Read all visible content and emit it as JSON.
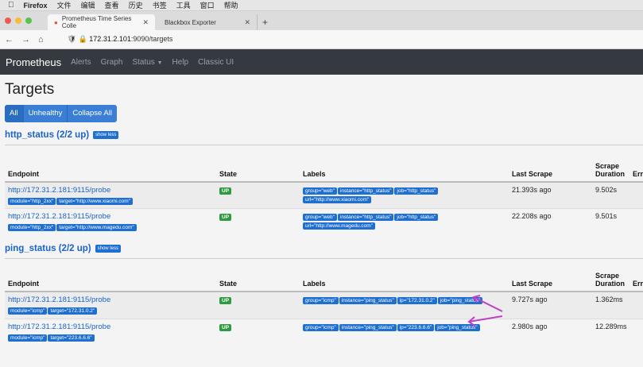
{
  "os_menu": {
    "app": "Firefox",
    "items": [
      "文件",
      "编辑",
      "查看",
      "历史",
      "书签",
      "工具",
      "窗口",
      "帮助"
    ]
  },
  "browser": {
    "tabs": [
      {
        "title": "Prometheus Time Series Colle"
      },
      {
        "title": "Blackbox Exporter"
      }
    ],
    "url_prefix": "172.31.2.101",
    "url_rest": ":9090/targets"
  },
  "nav": {
    "brand": "Prometheus",
    "links": [
      "Alerts",
      "Graph",
      "Status",
      "Help",
      "Classic UI"
    ]
  },
  "page": {
    "title": "Targets",
    "filters": [
      "All",
      "Unhealthy",
      "Collapse All"
    ],
    "show_less": "show less"
  },
  "columns": {
    "endpoint": "Endpoint",
    "state": "State",
    "labels": "Labels",
    "last_scrape": "Last Scrape",
    "scrape_duration": "Scrape Duration",
    "error": "Erro"
  },
  "jobs": [
    {
      "name": "http_status (2/2 up)",
      "rows": [
        {
          "endpoint": "http://172.31.2.181:9115/probe",
          "params": [
            "module=\"http_2xx\"",
            "target=\"http://www.xiaomi.com\""
          ],
          "state": "UP",
          "labels": [
            "group=\"web\"",
            "instance=\"http_status\"",
            "job=\"http_status\"",
            "url=\"http://www.xiaomi.com\""
          ],
          "last": "21.393s ago",
          "dur": "9.502s"
        },
        {
          "endpoint": "http://172.31.2.181:9115/probe",
          "params": [
            "module=\"http_2xx\"",
            "target=\"http://www.magedu.com\""
          ],
          "state": "UP",
          "labels": [
            "group=\"web\"",
            "instance=\"http_status\"",
            "job=\"http_status\"",
            "url=\"http://www.magedu.com\""
          ],
          "last": "22.208s ago",
          "dur": "9.501s"
        }
      ]
    },
    {
      "name": "ping_status (2/2 up)",
      "rows": [
        {
          "endpoint": "http://172.31.2.181:9115/probe",
          "params": [
            "module=\"icmp\"",
            "target=\"172.31.0.2\""
          ],
          "state": "UP",
          "labels": [
            "group=\"icmp\"",
            "instance=\"ping_status\"",
            "ip=\"172.31.0.2\"",
            "job=\"ping_status\""
          ],
          "last": "9.727s ago",
          "dur": "1.362ms"
        },
        {
          "endpoint": "http://172.31.2.181:9115/probe",
          "params": [
            "module=\"icmp\"",
            "target=\"223.6.6.6\""
          ],
          "state": "UP",
          "labels": [
            "group=\"icmp\"",
            "instance=\"ping_status\"",
            "ip=\"223.6.6.6\"",
            "job=\"ping_status\""
          ],
          "last": "2.980s ago",
          "dur": "12.289ms"
        }
      ]
    }
  ],
  "colors": {
    "navbar": "#343a40",
    "accent": "#1f6fd1",
    "up": "#2f9a3f",
    "annotation_arrow": "#c03fc8"
  }
}
